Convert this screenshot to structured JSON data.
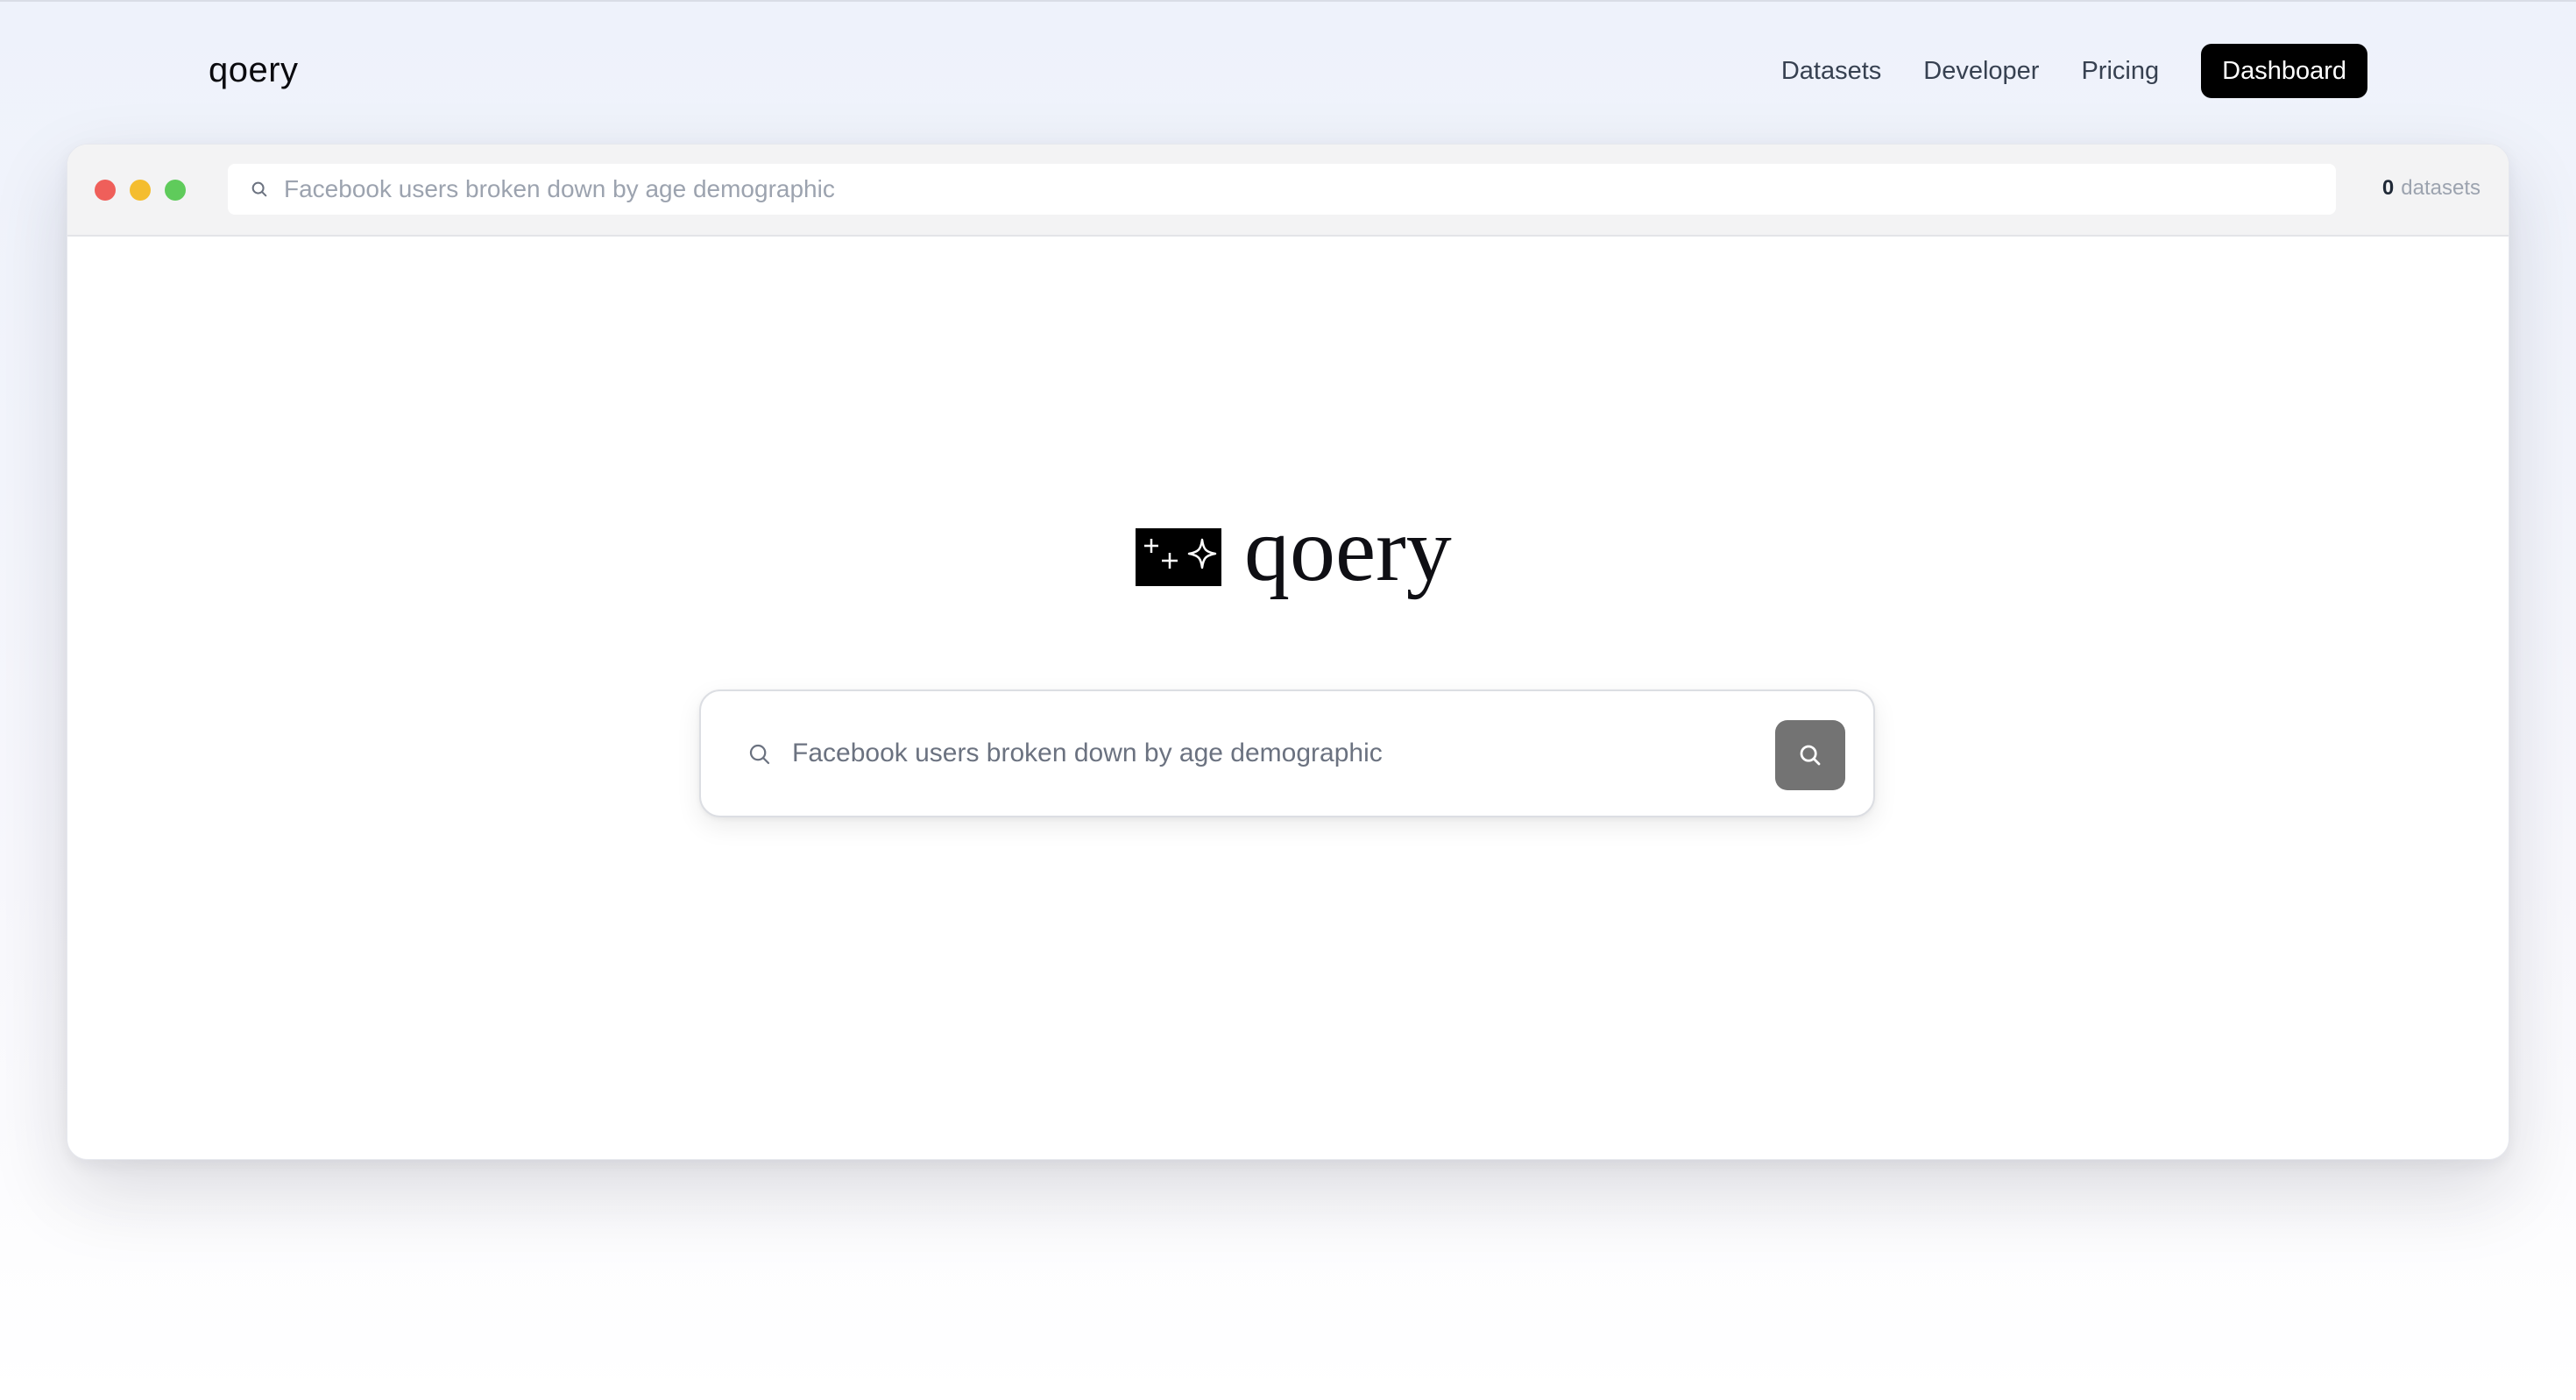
{
  "header": {
    "brand": "qoery",
    "nav": {
      "datasets": "Datasets",
      "developer": "Developer",
      "pricing": "Pricing",
      "dashboard": "Dashboard"
    }
  },
  "window": {
    "address_bar": {
      "placeholder": "Facebook users broken down by age demographic"
    },
    "dataset_count": {
      "value": "0",
      "label": "datasets"
    }
  },
  "hero": {
    "logo_word": "qoery",
    "search": {
      "placeholder": "Facebook users broken down by age demographic"
    }
  },
  "colors": {
    "accent": "#000000",
    "search_button": "#737373",
    "traffic_red": "#ef5f5a",
    "traffic_yellow": "#f4bd2f",
    "traffic_green": "#5fcb5b"
  },
  "icons": {
    "address_search": "search-icon",
    "main_search": "search-icon",
    "submit": "search-icon",
    "logo": "sparkles-icon"
  }
}
